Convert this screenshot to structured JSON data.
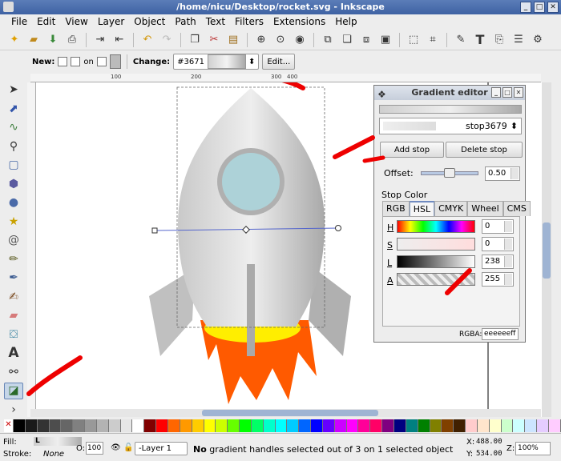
{
  "window": {
    "title": "/home/nicu/Desktop/rocket.svg - Inkscape"
  },
  "menu": [
    "File",
    "Edit",
    "View",
    "Layer",
    "Object",
    "Path",
    "Text",
    "Filters",
    "Extensions",
    "Help"
  ],
  "controls": {
    "new_label": "New:",
    "on_label": "on",
    "change_label": "Change:",
    "gradient_id": "#3671",
    "edit_label": "Edit..."
  },
  "ruler": {
    "top_labels": [
      "100",
      "200",
      "300",
      "400"
    ]
  },
  "gradient_editor": {
    "title": "Gradient editor",
    "stop_name": "stop3679",
    "add_stop": "Add stop",
    "delete_stop": "Delete stop",
    "offset_label": "Offset:",
    "offset_value": "0.50",
    "offset_level": 0.5,
    "stop_color_label": "Stop Color",
    "tabs": [
      "RGB",
      "HSL",
      "CMYK",
      "Wheel",
      "CMS"
    ],
    "active_tab": "HSL",
    "channels": [
      {
        "key": "H",
        "value": "0"
      },
      {
        "key": "S",
        "value": "0"
      },
      {
        "key": "L",
        "value": "238"
      },
      {
        "key": "A",
        "value": "255"
      }
    ],
    "rgba_label": "RGBA:",
    "rgba_value": "eeeeeeff"
  },
  "status": {
    "fill_label": "Fill:",
    "fill_value": "L",
    "stroke_label": "Stroke:",
    "stroke_value": "None",
    "opacity_label": "O:",
    "opacity_value": "100",
    "layer": "-Layer 1",
    "message_bold": "No",
    "message": " gradient handles selected out of 3 on 1 selected object",
    "x_label": "X:",
    "x_value": "488.00",
    "y_label": "Y:",
    "y_value": "534.00",
    "z_label": "Z:",
    "zoom": "100%"
  },
  "colors": {
    "accent": "#4a6aa8",
    "palette": [
      "#000000",
      "#1a1a1a",
      "#333333",
      "#4d4d4d",
      "#666666",
      "#808080",
      "#999999",
      "#b3b3b3",
      "#cccccc",
      "#e6e6e6",
      "#ffffff",
      "#800000",
      "#ff0000",
      "#ff6600",
      "#ff9900",
      "#ffcc00",
      "#ffff00",
      "#ccff00",
      "#66ff00",
      "#00ff00",
      "#00ff66",
      "#00ffcc",
      "#00ffff",
      "#00ccff",
      "#0066ff",
      "#0000ff",
      "#6600ff",
      "#cc00ff",
      "#ff00ff",
      "#ff0099",
      "#ff0066",
      "#800080",
      "#000080",
      "#008080",
      "#008000",
      "#808000",
      "#804000",
      "#402000",
      "#ffcccc",
      "#ffe5cc",
      "#ffffcc",
      "#ccffcc",
      "#ccffff",
      "#cce5ff",
      "#e5ccff",
      "#ffccff"
    ]
  }
}
